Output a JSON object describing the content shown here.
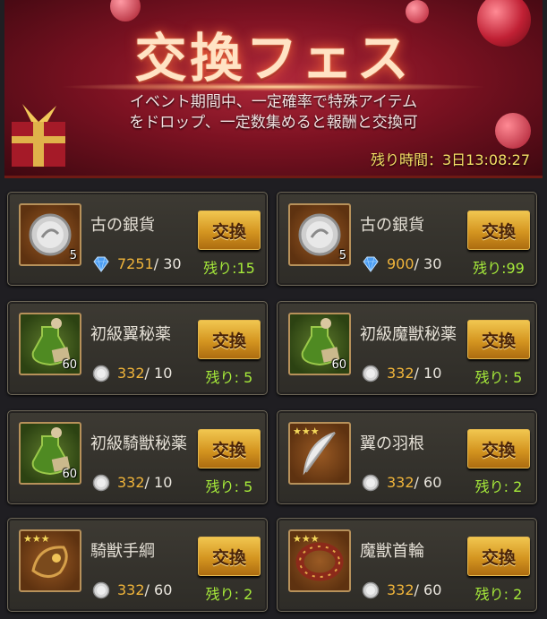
{
  "banner": {
    "title": "交換フェス",
    "desc_line1": "イベント期間中、一定確率で特殊アイテム",
    "desc_line2": "をドロップ、一定数集めると報酬と交換可",
    "timer": "残り時間：3日13:08:27"
  },
  "colors": {
    "accent_gold": "#f0b43a",
    "remain_green": "#a6ea3a",
    "timer_yellow": "#f5e066"
  },
  "items": [
    {
      "name": "古の銀貨",
      "icon": "silver-coin-icon",
      "count": "5",
      "cost_icon": "diamond-icon",
      "have": "7251",
      "need": "/ 30",
      "button": "交換",
      "remain": "残り:15"
    },
    {
      "name": "古の銀貨",
      "icon": "silver-coin-icon",
      "count": "5",
      "cost_icon": "diamond-icon",
      "have": "900",
      "need": "/ 30",
      "button": "交換",
      "remain": "残り:99"
    },
    {
      "name": "初級翼秘薬",
      "icon": "potion-icon",
      "count": "60",
      "cost_icon": "silver-coin-icon",
      "have": "332",
      "need": "/ 10",
      "button": "交換",
      "remain": "残り: 5"
    },
    {
      "name": "初級魔獣秘薬",
      "icon": "potion-icon",
      "count": "60",
      "cost_icon": "silver-coin-icon",
      "have": "332",
      "need": "/ 10",
      "button": "交換",
      "remain": "残り: 5"
    },
    {
      "name": "初級騎獣秘薬",
      "icon": "potion-icon",
      "count": "60",
      "cost_icon": "silver-coin-icon",
      "have": "332",
      "need": "/ 10",
      "button": "交換",
      "remain": "残り: 5"
    },
    {
      "name": "翼の羽根",
      "icon": "feather-icon",
      "count": "",
      "cost_icon": "silver-coin-icon",
      "have": "332",
      "need": "/ 60",
      "button": "交換",
      "remain": "残り: 2"
    },
    {
      "name": "騎獣手綱",
      "icon": "reins-icon",
      "count": "",
      "cost_icon": "silver-coin-icon",
      "have": "332",
      "need": "/ 60",
      "button": "交換",
      "remain": "残り: 2"
    },
    {
      "name": "魔獣首輪",
      "icon": "collar-icon",
      "count": "",
      "cost_icon": "silver-coin-icon",
      "have": "332",
      "need": "/ 60",
      "button": "交換",
      "remain": "残り: 2"
    }
  ]
}
